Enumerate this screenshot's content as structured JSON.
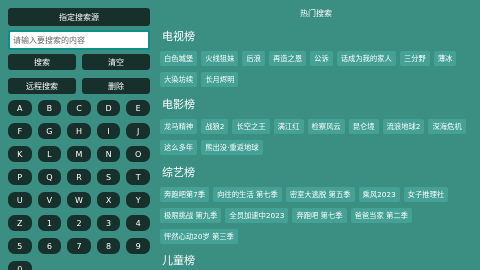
{
  "left": {
    "source_button": "指定搜索源",
    "search_placeholder": "请输入要搜索的内容",
    "search_button": "搜索",
    "clear_button": "清空",
    "remote_search_button": "远程搜索",
    "delete_button": "删除",
    "keys": [
      "A",
      "B",
      "C",
      "D",
      "E",
      "F",
      "G",
      "H",
      "I",
      "J",
      "K",
      "L",
      "M",
      "N",
      "O",
      "P",
      "Q",
      "R",
      "S",
      "T",
      "U",
      "V",
      "W",
      "X",
      "Y",
      "Z",
      "1",
      "2",
      "3",
      "4",
      "5",
      "6",
      "7",
      "8",
      "9",
      "0"
    ]
  },
  "right": {
    "header": "热门搜索",
    "sections": [
      {
        "title": "电视榜",
        "items": [
          "白色城堡",
          "火线狙妹",
          "后浪",
          "再造之恩",
          "公诉",
          "话成为我的家人",
          "三分野",
          "薄冰",
          "大染坊续",
          "长月烬明"
        ]
      },
      {
        "title": "电影榜",
        "items": [
          "龙马精神",
          "战狼2",
          "长空之王",
          "满江红",
          "检察风云",
          "昆仑境",
          "流浪地球2",
          "深海危机",
          "这么多年",
          "熊出没·重返地球"
        ]
      },
      {
        "title": "综艺榜",
        "items": [
          "奔跑吧第7季",
          "向往的生活 第七季",
          "密室大逃脱 第五季",
          "乘风2023",
          "女子推理社",
          "极限挑战 第九季",
          "全员加速中2023",
          "奔跑吧 第七季",
          "爸爸当家 第二季",
          "怦然心动20岁 第三季"
        ]
      },
      {
        "title": "儿童榜",
        "items": []
      }
    ]
  }
}
